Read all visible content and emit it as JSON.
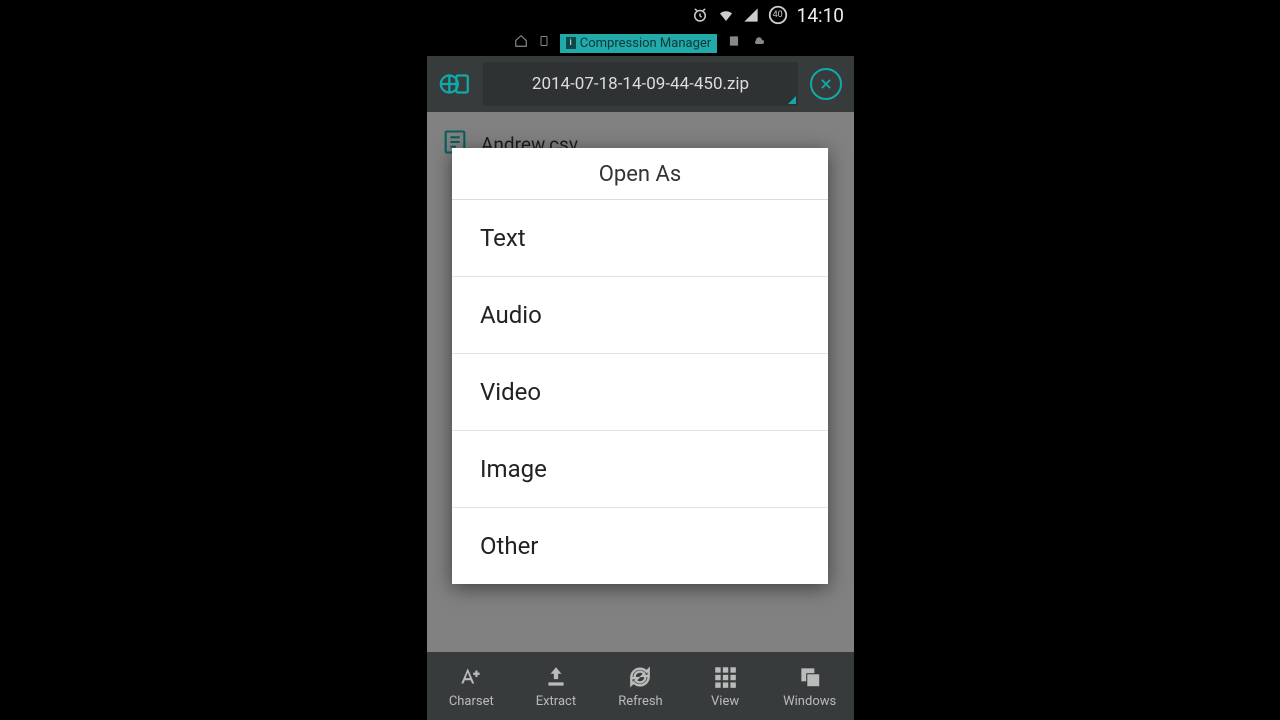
{
  "status": {
    "time": "14:10",
    "battery_text": "40"
  },
  "nav": {
    "app_title": "Compression Manager"
  },
  "toolbar": {
    "archive_name": "2014-07-18-14-09-44-450.zip"
  },
  "file": {
    "name": "Andrew.csv"
  },
  "bottom": {
    "items": [
      {
        "label": "Charset"
      },
      {
        "label": "Extract"
      },
      {
        "label": "Refresh"
      },
      {
        "label": "View"
      },
      {
        "label": "Windows"
      }
    ]
  },
  "dialog": {
    "title": "Open As",
    "options": [
      {
        "label": "Text"
      },
      {
        "label": "Audio"
      },
      {
        "label": "Video"
      },
      {
        "label": "Image"
      },
      {
        "label": "Other"
      }
    ]
  }
}
